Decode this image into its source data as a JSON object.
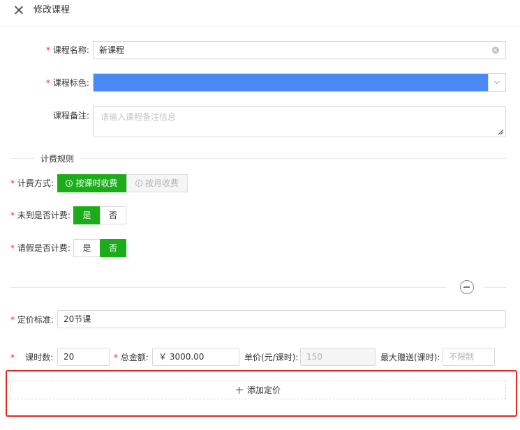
{
  "header": {
    "title": "修改课程"
  },
  "form": {
    "course_name": {
      "label": "课程名称:",
      "value": "新课程"
    },
    "course_color": {
      "label": "课程标色:",
      "color": "#4a8af4"
    },
    "course_note": {
      "label": "课程备注:",
      "placeholder": "请输入课程备注信息"
    }
  },
  "billing": {
    "section_title": "计费规则",
    "method": {
      "label": "计费方式:",
      "options": [
        "按课时收费",
        "按月收费"
      ],
      "selected": "按课时收费"
    },
    "absent": {
      "label": "未到是否计费:",
      "options": [
        "是",
        "否"
      ],
      "selected": "是"
    },
    "leave": {
      "label": "请假是否计费:",
      "options": [
        "是",
        "否"
      ],
      "selected": "否"
    }
  },
  "pricing": {
    "standard": {
      "label": "定价标准:",
      "value": "20节课"
    },
    "hours": {
      "label": "课时数:",
      "value": "20"
    },
    "total": {
      "label": "总金额:",
      "value": "￥ 3000.00"
    },
    "unit_price": {
      "label": "单价(元/课时):",
      "value": "150"
    },
    "max_gift": {
      "label": "最大赠送(课时):",
      "value": "不限制"
    },
    "add_label": "添加定价"
  },
  "colors": {
    "accent": "#1aad19",
    "required": "#f5222d",
    "highlight_box": "#e0281e"
  }
}
